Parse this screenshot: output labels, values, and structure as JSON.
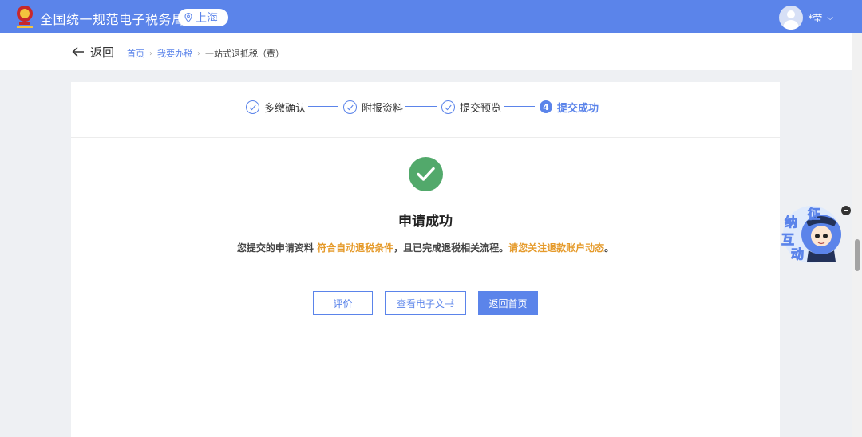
{
  "header": {
    "site_title": "全国统一规范电子税务局",
    "region": "上海",
    "user_name": "*莹"
  },
  "subheader": {
    "back_label": "返回",
    "breadcrumb": [
      "首页",
      "我要办税",
      "一站式退抵税（费）"
    ]
  },
  "steps": [
    {
      "label": "多缴确认",
      "state": "done"
    },
    {
      "label": "附报资料",
      "state": "done"
    },
    {
      "label": "提交预览",
      "state": "done"
    },
    {
      "label": "提交成功",
      "state": "active",
      "number": "4"
    }
  ],
  "result": {
    "title": "申请成功",
    "msg_part1": "您提交的申请资料 ",
    "msg_highlight1": "符合自动退税条件",
    "msg_part2": "，且已完成退税相关流程。",
    "msg_highlight2": "请您关注退款账户动态",
    "msg_part3": "。"
  },
  "actions": {
    "evaluate_label": "评价",
    "view_doc_label": "查看电子文书",
    "home_label": "返回首页"
  },
  "widget": {
    "chars": [
      "征",
      "纳",
      "互",
      "动"
    ]
  },
  "colors": {
    "brand": "#5b84ea",
    "success": "#52a96b",
    "highlight": "#e59a2a"
  }
}
